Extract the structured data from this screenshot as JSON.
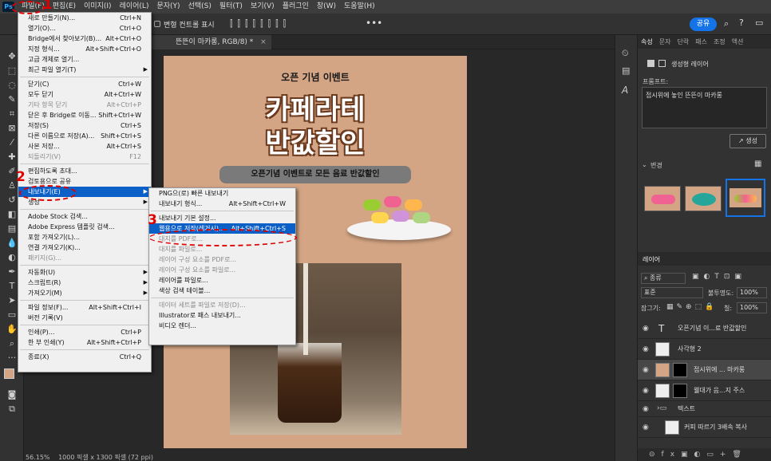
{
  "menubar": {
    "logo": "Ps",
    "items": [
      "파일(F)",
      "편집(E)",
      "이미지(I)",
      "레이어(L)",
      "문자(Y)",
      "선택(S)",
      "필터(T)",
      "보기(V)",
      "플러그인",
      "창(W)",
      "도움말(H)"
    ]
  },
  "optbar": {
    "transform_label": "변형 컨트롤 표시",
    "share_label": "공유"
  },
  "doctab": {
    "title": "뜬뜬이 마카롱, RGB/8) *"
  },
  "status": {
    "zoom": "56.15%",
    "size": "1000 픽셀 x 1300 픽셀 (72 ppi)"
  },
  "file_menu": [
    {
      "label": "새로 만들기(N)...",
      "shortcut": "Ctrl+N",
      "disabled": false,
      "sub": false
    },
    {
      "label": "열기(O)...",
      "shortcut": "Ctrl+O",
      "disabled": false,
      "sub": false
    },
    {
      "label": "Bridge에서 찾아보기(B)...",
      "shortcut": "Alt+Ctrl+O",
      "disabled": false,
      "sub": false
    },
    {
      "label": "지정 형식...",
      "shortcut": "Alt+Shift+Ctrl+O",
      "disabled": false,
      "sub": false
    },
    {
      "label": "고급 개체로 열기...",
      "shortcut": "",
      "disabled": false,
      "sub": false
    },
    {
      "label": "최근 파일 열기(T)",
      "shortcut": "",
      "disabled": false,
      "sub": true
    },
    {
      "sep": true
    },
    {
      "label": "닫기(C)",
      "shortcut": "Ctrl+W",
      "disabled": false,
      "sub": false
    },
    {
      "label": "모두 닫기",
      "shortcut": "Alt+Ctrl+W",
      "disabled": false,
      "sub": false
    },
    {
      "label": "기타 항목 닫기",
      "shortcut": "Alt+Ctrl+P",
      "disabled": true,
      "sub": false
    },
    {
      "label": "닫은 후 Bridge로 이동...",
      "shortcut": "Shift+Ctrl+W",
      "disabled": false,
      "sub": false
    },
    {
      "label": "저장(S)",
      "shortcut": "Ctrl+S",
      "disabled": false,
      "sub": false
    },
    {
      "label": "다른 이름으로 저장(A)...",
      "shortcut": "Shift+Ctrl+S",
      "disabled": false,
      "sub": false
    },
    {
      "label": "사본 저장...",
      "shortcut": "Alt+Ctrl+S",
      "disabled": false,
      "sub": false
    },
    {
      "label": "되돌리기(V)",
      "shortcut": "F12",
      "disabled": true,
      "sub": false
    },
    {
      "sep": true
    },
    {
      "label": "편집하도록 초대...",
      "shortcut": "",
      "disabled": false,
      "sub": false
    },
    {
      "label": "검토용으로 공유",
      "shortcut": "",
      "disabled": false,
      "sub": false
    },
    {
      "label": "내보내기(E)",
      "shortcut": "",
      "disabled": false,
      "sub": true,
      "highlight": true
    },
    {
      "label": "생성",
      "shortcut": "",
      "disabled": false,
      "sub": true
    },
    {
      "sep": true
    },
    {
      "label": "Adobe Stock 검색...",
      "shortcut": "",
      "disabled": false,
      "sub": false
    },
    {
      "label": "Adobe Express 템플릿 검색...",
      "shortcut": "",
      "disabled": false,
      "sub": false
    },
    {
      "label": "포함 가져오기(L)...",
      "shortcut": "",
      "disabled": false,
      "sub": false
    },
    {
      "label": "연결 가져오기(K)...",
      "shortcut": "",
      "disabled": false,
      "sub": false
    },
    {
      "label": "패키지(G)...",
      "shortcut": "",
      "disabled": true,
      "sub": false
    },
    {
      "sep": true
    },
    {
      "label": "자동화(U)",
      "shortcut": "",
      "disabled": false,
      "sub": true
    },
    {
      "label": "스크립트(R)",
      "shortcut": "",
      "disabled": false,
      "sub": true
    },
    {
      "label": "가져오기(M)",
      "shortcut": "",
      "disabled": false,
      "sub": true
    },
    {
      "sep": true
    },
    {
      "label": "파일 정보(F)...",
      "shortcut": "Alt+Shift+Ctrl+I",
      "disabled": false,
      "sub": false
    },
    {
      "label": "버전 기록(V)",
      "shortcut": "",
      "disabled": false,
      "sub": false
    },
    {
      "sep": true
    },
    {
      "label": "인쇄(P)...",
      "shortcut": "Ctrl+P",
      "disabled": false,
      "sub": false
    },
    {
      "label": "한 부 인쇄(Y)",
      "shortcut": "Alt+Shift+Ctrl+P",
      "disabled": false,
      "sub": false
    },
    {
      "sep": true
    },
    {
      "label": "종료(X)",
      "shortcut": "Ctrl+Q",
      "disabled": false,
      "sub": false
    }
  ],
  "export_menu": [
    {
      "label": "PNG으(로) 빠른 내보내기",
      "shortcut": "",
      "disabled": false
    },
    {
      "label": "내보내기 형식...",
      "shortcut": "Alt+Shift+Ctrl+W",
      "disabled": false
    },
    {
      "sep": true
    },
    {
      "label": "내보내기 기본 설정...",
      "shortcut": "",
      "disabled": false
    },
    {
      "label": "웹용으로 저장(레거시)...",
      "shortcut": "Alt+Shift+Ctrl+S",
      "disabled": false,
      "highlight": true
    },
    {
      "label": "대지를 PDF로...",
      "shortcut": "",
      "disabled": true
    },
    {
      "label": "대지를 파일로...",
      "shortcut": "",
      "disabled": true
    },
    {
      "label": "레이어 구성 요소를 PDF로...",
      "shortcut": "",
      "disabled": true
    },
    {
      "label": "레이어 구성 요소를 파일로...",
      "shortcut": "",
      "disabled": true
    },
    {
      "label": "레이어를 파일로...",
      "shortcut": "",
      "disabled": false
    },
    {
      "label": "색상 검색 테이블...",
      "shortcut": "",
      "disabled": false
    },
    {
      "sep": true
    },
    {
      "label": "데이터 세트를 파일로 저장(D)...",
      "shortcut": "",
      "disabled": true
    },
    {
      "label": "Illustrator로 패스 내보내기...",
      "shortcut": "",
      "disabled": false
    },
    {
      "label": "비디오 렌더...",
      "shortcut": "",
      "disabled": false
    }
  ],
  "annotations": {
    "step1": "1",
    "step2": "2",
    "step3": "3"
  },
  "poster": {
    "top_text": "오픈 기념 이벤트",
    "title_line1": "카페라테",
    "title_line2": "반값할인",
    "banner": "오픈기념 이벤트로 모든 음료 반값할인"
  },
  "props_panel": {
    "tabs": [
      "속성",
      "문자",
      "단락",
      "패스",
      "조정",
      "액션"
    ],
    "layer_type": "생성형 레이어",
    "prompt_label": "프롬프트:",
    "prompt_value": "접시위에 놓인 뜬뜬이 마카롱",
    "generate_label": "생성",
    "variations_label": "변경"
  },
  "layers_panel": {
    "tab": "레이어",
    "filter": "종류",
    "blend": "표준",
    "opacity_label": "불투명도:",
    "opacity": "100%",
    "lock_label": "잠그기:",
    "fill_label": "칠:",
    "fill": "100%",
    "layers": [
      {
        "name": "오픈기념 이...료 반값할인",
        "kind": "text"
      },
      {
        "name": "사각형 2",
        "kind": "shape"
      },
      {
        "name": "접시위에 ... 마카롱",
        "kind": "mask",
        "selected": true
      },
      {
        "name": "웰대가 음...지 주스",
        "kind": "mask"
      },
      {
        "name": "텍스트",
        "kind": "group"
      },
      {
        "name": "커피 따르기 3배속 복사",
        "kind": "video"
      }
    ]
  },
  "colors": {
    "accent": "#0b60c8",
    "annotation_red": "#e00000",
    "poster_bg": "#d4a584"
  }
}
